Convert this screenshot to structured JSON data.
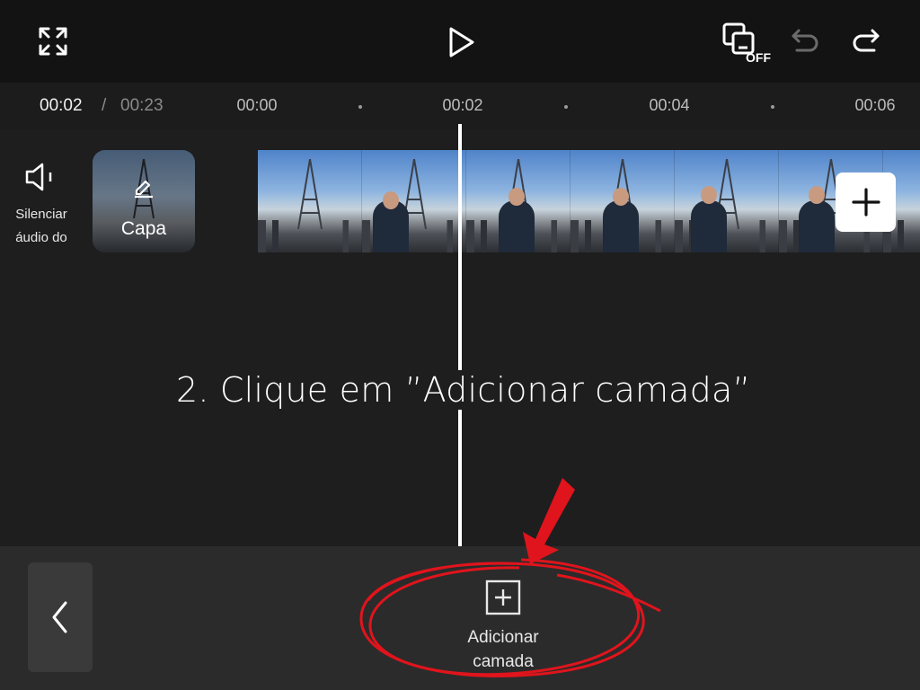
{
  "toolbar": {
    "expand_icon": "fullscreen-icon",
    "play_icon": "play-icon",
    "pip_icon": "picture-in-picture-off-icon",
    "pip_badge": "OFF",
    "undo_icon": "undo-icon",
    "redo_icon": "redo-icon"
  },
  "timeline": {
    "current_time": "00:02",
    "separator": "/",
    "total_time": "00:23",
    "ticks": [
      "00:00",
      "00:02",
      "00:04",
      "00:06"
    ]
  },
  "track": {
    "mute_label_line1": "Silenciar",
    "mute_label_line2": "áudio do",
    "cover_label": "Capa"
  },
  "instruction": "2. Clique em ”Adicionar camada”",
  "bottom": {
    "add_layer_label_line1": "Adicionar",
    "add_layer_label_line2": "camada"
  },
  "colors": {
    "annotation_red": "#e0141c",
    "background": "#1e1e1e"
  }
}
